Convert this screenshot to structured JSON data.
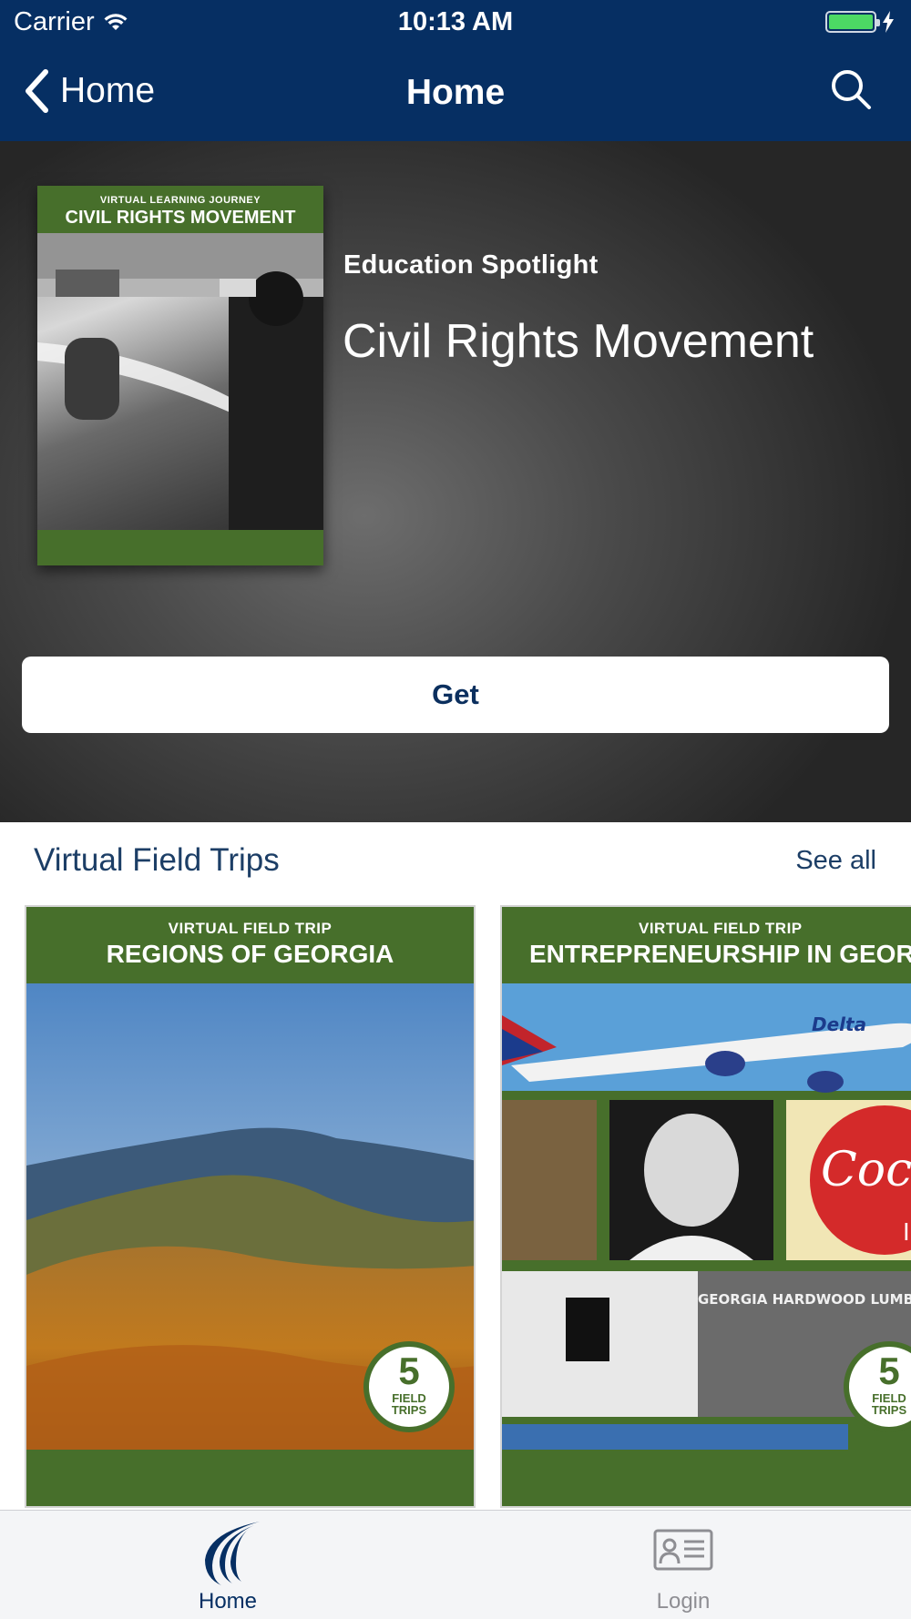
{
  "status_bar": {
    "carrier": "Carrier",
    "time": "10:13 AM"
  },
  "nav": {
    "back_label": "Home",
    "title": "Home",
    "back_icon": "chevron-left-icon",
    "search_icon": "search-icon"
  },
  "spotlight": {
    "cover_small": "VIRTUAL LEARNING JOURNEY",
    "cover_big": "CIVIL RIGHTS MOVEMENT",
    "label": "Education Spotlight",
    "title": "Civil Rights Movement",
    "button": "Get"
  },
  "section": {
    "title": "Virtual Field Trips",
    "see_all": "See all",
    "cards": [
      {
        "small": "VIRTUAL FIELD TRIP",
        "big": "REGIONS OF GEORGIA",
        "badge_num": "5",
        "badge_l1": "FIELD",
        "badge_l2": "TRIPS"
      },
      {
        "small": "VIRTUAL FIELD TRIP",
        "big": "ENTREPRENEURSHIP IN GEORGIA",
        "badge_num": "5",
        "badge_l1": "FIELD",
        "badge_l2": "TRIPS",
        "sign": "GEORGIA HARDWOOD LUMBER CO.",
        "logo": "Coca",
        "airline": "Delta",
        "logo_tail": "ISK"
      }
    ]
  },
  "tabbar": {
    "home": "Home",
    "login": "Login"
  },
  "colors": {
    "navy": "#062f63",
    "green": "#476f2b",
    "link": "#1c3e66"
  }
}
